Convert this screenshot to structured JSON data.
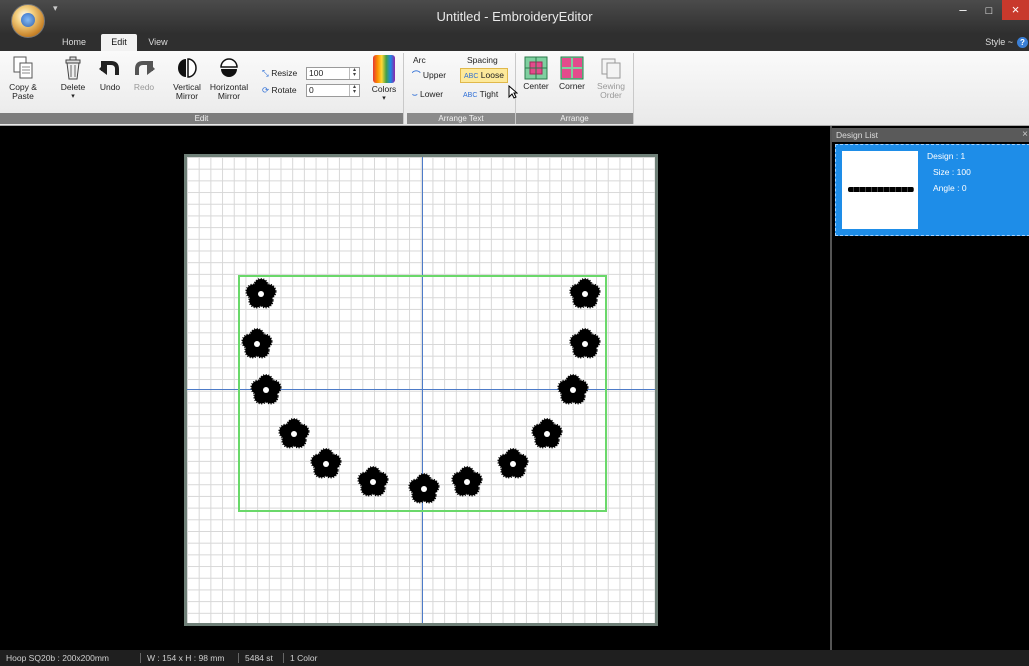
{
  "window": {
    "title": "Untitled - EmbroideryEditor",
    "minimize": "–",
    "maximize": "□",
    "close": "×"
  },
  "tabs": [
    {
      "label": "Home"
    },
    {
      "label": "Edit",
      "active": true
    },
    {
      "label": "View"
    }
  ],
  "style_menu": "Style ~",
  "help_icon": "?",
  "ribbon": {
    "edit_group": {
      "label": "Edit",
      "copy_paste": "Copy & Paste",
      "delete": "Delete",
      "undo": "Undo",
      "redo": "Redo",
      "vertical_mirror": "Vertical Mirror",
      "horizontal_mirror": "Horizontal Mirror",
      "resize_label": "Resize",
      "resize_value": "100",
      "rotate_label": "Rotate",
      "rotate_value": "0",
      "colors": "Colors"
    },
    "arrange_text_group": {
      "label": "Arrange Text",
      "arc_label": "Arc",
      "upper": "Upper",
      "lower": "Lower",
      "spacing_label": "Spacing",
      "loose": "Loose",
      "tight": "Tight"
    },
    "arrange_group": {
      "label": "Arrange",
      "center": "Center",
      "corner": "Corner",
      "sewing_order": "Sewing Order"
    }
  },
  "design_list": {
    "title": "Design List",
    "close": "×",
    "items": [
      {
        "design": "Design : 1",
        "size": "Size : 100",
        "angle": "Angle : 0"
      }
    ]
  },
  "status": {
    "hoop": "Hoop SQ20b : 200x200mm",
    "dimensions": "W : 154 x H : 98 mm",
    "stitches": "5484 st",
    "colors": "1 Color"
  },
  "colors": {
    "accent": "#1e8de8",
    "bounding_box": "#6ad86a",
    "axis": "#4d7bc8"
  }
}
